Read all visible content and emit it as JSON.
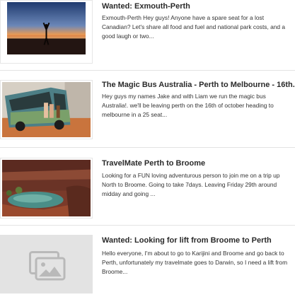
{
  "listings": [
    {
      "title": "Wanted: Exmouth-Perth",
      "description": "Exmouth-Perth Hey guys! Anyone have a spare seat for a lost Canadian? Let's share all food and fuel and national park costs, and a good laugh or two...",
      "image": "sunset-beach-yoga-photo"
    },
    {
      "title": "The Magic Bus Australia - Perth to Melbourne - 16th...",
      "description": "Hey guys my names Jake  and with Liam we run the magic bus Australia!. we'll be leaving perth on the 16th of october heading to melbourne in a 25 seat...",
      "image": "painted-bus-photo"
    },
    {
      "title": "TravelMate Perth to Broome",
      "description": "Looking for a FUN loving adventurous person to join me on a trip up North to Broome. Going to take 7days. Leaving Friday 29th around midday and going ...",
      "image": "gorge-waterhole-photo"
    },
    {
      "title": "Wanted: Looking for lift from Broome to Perth",
      "description": "Hello everyone, I'm about to go to Karijini and Broome and go back to Perth, unfortunately my travelmate goes to Darwin, so I need a lift from Broome...",
      "image": "image-placeholder-icon"
    }
  ]
}
